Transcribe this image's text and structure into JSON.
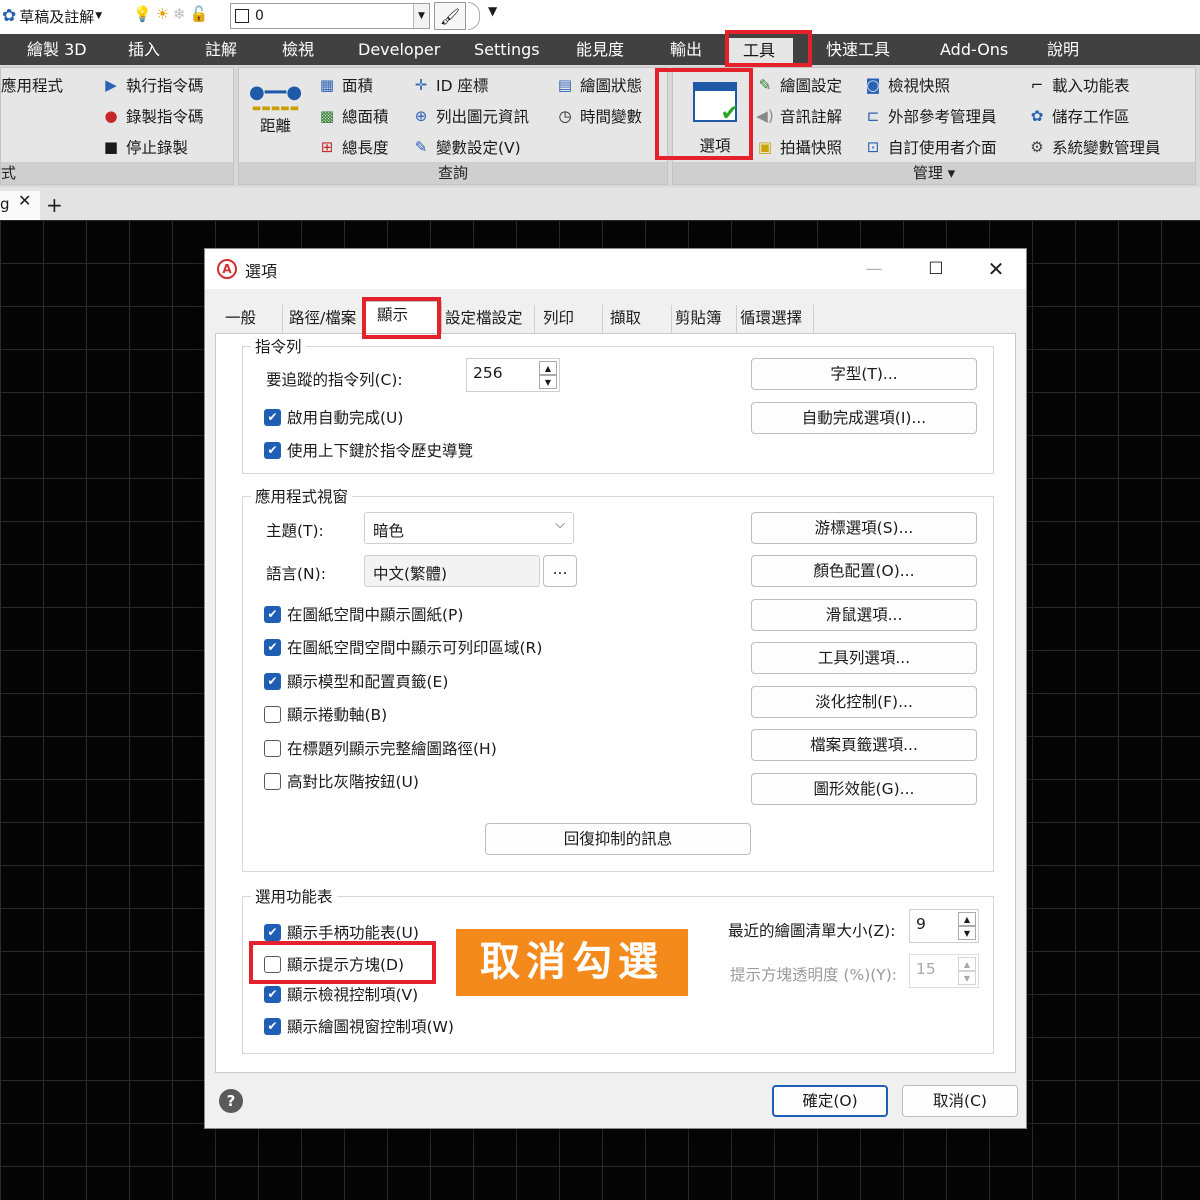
{
  "quick_access": {
    "workspace": "草稿及註解",
    "layer_value": "0"
  },
  "ribbon_tabs": [
    "繪製 3D",
    "插入",
    "註解",
    "檢視",
    "Developer",
    "Settings",
    "能見度",
    "輸出",
    "工具",
    "快速工具",
    "Add-Ons",
    "說明"
  ],
  "ribbon": {
    "apps_panel": {
      "items": [
        "應用程式",
        "執行指令碼",
        "錄製指令碼",
        "停止錄製"
      ],
      "label": "式"
    },
    "query_panel": {
      "distance": "距離",
      "items": [
        "面積",
        "ID 座標",
        "繪圖狀態",
        "總面積",
        "列出圖元資訊",
        "時間變數",
        "總長度",
        "變數設定(V)"
      ],
      "label": "查詢"
    },
    "manage_panel": {
      "options_button": "選項",
      "items": [
        "繪圖設定",
        "檢視快照",
        "載入功能表",
        "音訊註解",
        "外部參考管理員",
        "儲存工作區",
        "拍攝快照",
        "自訂使用者介面",
        "系統變數管理員"
      ],
      "label": "管理 ▾"
    }
  },
  "doc_tab": {
    "name": "g"
  },
  "dialog": {
    "title": "選項",
    "tabs": [
      "一般",
      "路徑/檔案",
      "顯示",
      "設定檔設定",
      "列印",
      "擷取",
      "剪貼簿",
      "循環選擇"
    ],
    "selected_tab": "顯示",
    "command_line": {
      "title": "指令列",
      "lines_label": "要追蹤的指令列(C):",
      "lines_value": "256",
      "autocomplete": "啟用自動完成(U)",
      "history_keys": "使用上下鍵於指令歷史導覽",
      "font_button": "字型(T)...",
      "autocomplete_options_button": "自動完成選項(I)..."
    },
    "app_window": {
      "title": "應用程式視窗",
      "theme_label": "主題(T):",
      "theme_value": "暗色",
      "language_label": "語言(N):",
      "language_value": "中文(繁體)",
      "language_browse": "...",
      "checkboxes": [
        {
          "label": "在圖紙空間中顯示圖紙(P)",
          "checked": true
        },
        {
          "label": "在圖紙空間空間中顯示可列印區域(R)",
          "checked": true
        },
        {
          "label": "顯示模型和配置頁籤(E)",
          "checked": true
        },
        {
          "label": "顯示捲動軸(B)",
          "checked": false
        },
        {
          "label": "在標題列顯示完整繪圖路徑(H)",
          "checked": false
        },
        {
          "label": "高對比灰階按鈕(U)",
          "checked": false
        }
      ],
      "buttons": [
        "游標選項(S)...",
        "顏色配置(O)...",
        "滑鼠選項...",
        "工具列選項...",
        "淡化控制(F)...",
        "檔案頁籤選項...",
        "圖形效能(G)..."
      ],
      "restore_button": "回復抑制的訊息"
    },
    "menus": {
      "title": "選用功能表",
      "checkboxes": [
        {
          "label": "顯示手柄功能表(U)",
          "checked": true
        },
        {
          "label": "顯示提示方塊(D)",
          "checked": false
        },
        {
          "label": "顯示檢視控制項(V)",
          "checked": true
        },
        {
          "label": "顯示繪圖視窗控制項(W)",
          "checked": true
        }
      ],
      "recent_label": "最近的繪圖清單大小(Z):",
      "recent_value": "9",
      "tooltip_label": "提示方塊透明度 (%)(Y):",
      "tooltip_value": "15"
    },
    "ok_button": "確定(O)",
    "cancel_button": "取消(C)"
  },
  "annotation": {
    "text": "取消勾選",
    "highlight_color": "#e5222b",
    "label_bg": "#f48a1c"
  }
}
